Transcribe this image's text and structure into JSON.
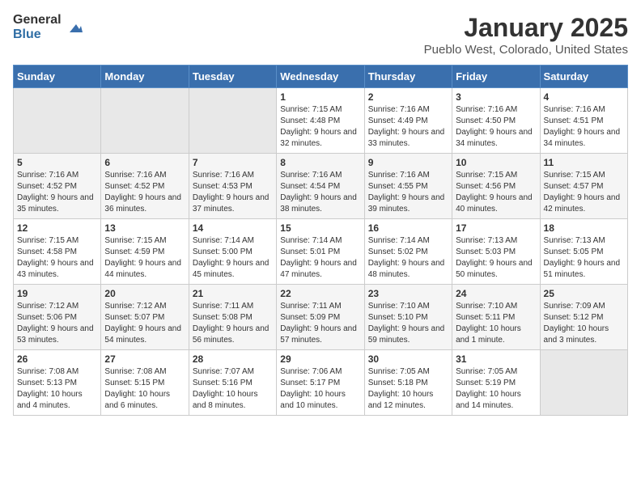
{
  "logo": {
    "general": "General",
    "blue": "Blue"
  },
  "header": {
    "title": "January 2025",
    "location": "Pueblo West, Colorado, United States"
  },
  "weekdays": [
    "Sunday",
    "Monday",
    "Tuesday",
    "Wednesday",
    "Thursday",
    "Friday",
    "Saturday"
  ],
  "weeks": [
    [
      {
        "day": "",
        "info": ""
      },
      {
        "day": "",
        "info": ""
      },
      {
        "day": "",
        "info": ""
      },
      {
        "day": "1",
        "info": "Sunrise: 7:15 AM\nSunset: 4:48 PM\nDaylight: 9 hours and 32 minutes."
      },
      {
        "day": "2",
        "info": "Sunrise: 7:16 AM\nSunset: 4:49 PM\nDaylight: 9 hours and 33 minutes."
      },
      {
        "day": "3",
        "info": "Sunrise: 7:16 AM\nSunset: 4:50 PM\nDaylight: 9 hours and 34 minutes."
      },
      {
        "day": "4",
        "info": "Sunrise: 7:16 AM\nSunset: 4:51 PM\nDaylight: 9 hours and 34 minutes."
      }
    ],
    [
      {
        "day": "5",
        "info": "Sunrise: 7:16 AM\nSunset: 4:52 PM\nDaylight: 9 hours and 35 minutes."
      },
      {
        "day": "6",
        "info": "Sunrise: 7:16 AM\nSunset: 4:52 PM\nDaylight: 9 hours and 36 minutes."
      },
      {
        "day": "7",
        "info": "Sunrise: 7:16 AM\nSunset: 4:53 PM\nDaylight: 9 hours and 37 minutes."
      },
      {
        "day": "8",
        "info": "Sunrise: 7:16 AM\nSunset: 4:54 PM\nDaylight: 9 hours and 38 minutes."
      },
      {
        "day": "9",
        "info": "Sunrise: 7:16 AM\nSunset: 4:55 PM\nDaylight: 9 hours and 39 minutes."
      },
      {
        "day": "10",
        "info": "Sunrise: 7:15 AM\nSunset: 4:56 PM\nDaylight: 9 hours and 40 minutes."
      },
      {
        "day": "11",
        "info": "Sunrise: 7:15 AM\nSunset: 4:57 PM\nDaylight: 9 hours and 42 minutes."
      }
    ],
    [
      {
        "day": "12",
        "info": "Sunrise: 7:15 AM\nSunset: 4:58 PM\nDaylight: 9 hours and 43 minutes."
      },
      {
        "day": "13",
        "info": "Sunrise: 7:15 AM\nSunset: 4:59 PM\nDaylight: 9 hours and 44 minutes."
      },
      {
        "day": "14",
        "info": "Sunrise: 7:14 AM\nSunset: 5:00 PM\nDaylight: 9 hours and 45 minutes."
      },
      {
        "day": "15",
        "info": "Sunrise: 7:14 AM\nSunset: 5:01 PM\nDaylight: 9 hours and 47 minutes."
      },
      {
        "day": "16",
        "info": "Sunrise: 7:14 AM\nSunset: 5:02 PM\nDaylight: 9 hours and 48 minutes."
      },
      {
        "day": "17",
        "info": "Sunrise: 7:13 AM\nSunset: 5:03 PM\nDaylight: 9 hours and 50 minutes."
      },
      {
        "day": "18",
        "info": "Sunrise: 7:13 AM\nSunset: 5:05 PM\nDaylight: 9 hours and 51 minutes."
      }
    ],
    [
      {
        "day": "19",
        "info": "Sunrise: 7:12 AM\nSunset: 5:06 PM\nDaylight: 9 hours and 53 minutes."
      },
      {
        "day": "20",
        "info": "Sunrise: 7:12 AM\nSunset: 5:07 PM\nDaylight: 9 hours and 54 minutes."
      },
      {
        "day": "21",
        "info": "Sunrise: 7:11 AM\nSunset: 5:08 PM\nDaylight: 9 hours and 56 minutes."
      },
      {
        "day": "22",
        "info": "Sunrise: 7:11 AM\nSunset: 5:09 PM\nDaylight: 9 hours and 57 minutes."
      },
      {
        "day": "23",
        "info": "Sunrise: 7:10 AM\nSunset: 5:10 PM\nDaylight: 9 hours and 59 minutes."
      },
      {
        "day": "24",
        "info": "Sunrise: 7:10 AM\nSunset: 5:11 PM\nDaylight: 10 hours and 1 minute."
      },
      {
        "day": "25",
        "info": "Sunrise: 7:09 AM\nSunset: 5:12 PM\nDaylight: 10 hours and 3 minutes."
      }
    ],
    [
      {
        "day": "26",
        "info": "Sunrise: 7:08 AM\nSunset: 5:13 PM\nDaylight: 10 hours and 4 minutes."
      },
      {
        "day": "27",
        "info": "Sunrise: 7:08 AM\nSunset: 5:15 PM\nDaylight: 10 hours and 6 minutes."
      },
      {
        "day": "28",
        "info": "Sunrise: 7:07 AM\nSunset: 5:16 PM\nDaylight: 10 hours and 8 minutes."
      },
      {
        "day": "29",
        "info": "Sunrise: 7:06 AM\nSunset: 5:17 PM\nDaylight: 10 hours and 10 minutes."
      },
      {
        "day": "30",
        "info": "Sunrise: 7:05 AM\nSunset: 5:18 PM\nDaylight: 10 hours and 12 minutes."
      },
      {
        "day": "31",
        "info": "Sunrise: 7:05 AM\nSunset: 5:19 PM\nDaylight: 10 hours and 14 minutes."
      },
      {
        "day": "",
        "info": ""
      }
    ]
  ]
}
